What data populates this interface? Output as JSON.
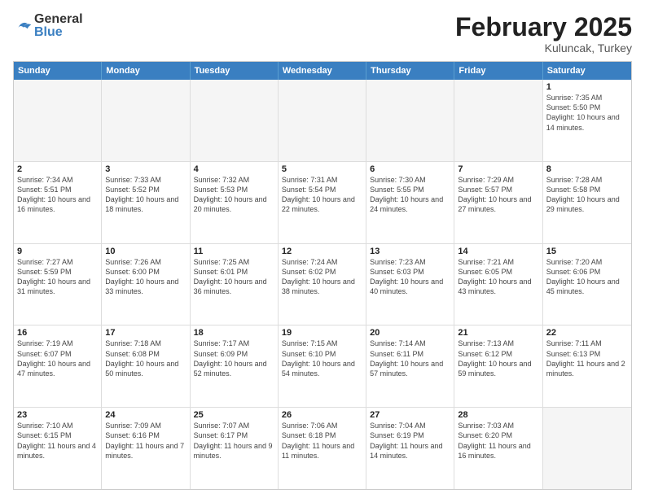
{
  "header": {
    "logo_general": "General",
    "logo_blue": "Blue",
    "title": "February 2025",
    "subtitle": "Kuluncak, Turkey"
  },
  "days_of_week": [
    "Sunday",
    "Monday",
    "Tuesday",
    "Wednesday",
    "Thursday",
    "Friday",
    "Saturday"
  ],
  "weeks": [
    [
      {
        "day": "",
        "info": ""
      },
      {
        "day": "",
        "info": ""
      },
      {
        "day": "",
        "info": ""
      },
      {
        "day": "",
        "info": ""
      },
      {
        "day": "",
        "info": ""
      },
      {
        "day": "",
        "info": ""
      },
      {
        "day": "1",
        "info": "Sunrise: 7:35 AM\nSunset: 5:50 PM\nDaylight: 10 hours and 14 minutes."
      }
    ],
    [
      {
        "day": "2",
        "info": "Sunrise: 7:34 AM\nSunset: 5:51 PM\nDaylight: 10 hours and 16 minutes."
      },
      {
        "day": "3",
        "info": "Sunrise: 7:33 AM\nSunset: 5:52 PM\nDaylight: 10 hours and 18 minutes."
      },
      {
        "day": "4",
        "info": "Sunrise: 7:32 AM\nSunset: 5:53 PM\nDaylight: 10 hours and 20 minutes."
      },
      {
        "day": "5",
        "info": "Sunrise: 7:31 AM\nSunset: 5:54 PM\nDaylight: 10 hours and 22 minutes."
      },
      {
        "day": "6",
        "info": "Sunrise: 7:30 AM\nSunset: 5:55 PM\nDaylight: 10 hours and 24 minutes."
      },
      {
        "day": "7",
        "info": "Sunrise: 7:29 AM\nSunset: 5:57 PM\nDaylight: 10 hours and 27 minutes."
      },
      {
        "day": "8",
        "info": "Sunrise: 7:28 AM\nSunset: 5:58 PM\nDaylight: 10 hours and 29 minutes."
      }
    ],
    [
      {
        "day": "9",
        "info": "Sunrise: 7:27 AM\nSunset: 5:59 PM\nDaylight: 10 hours and 31 minutes."
      },
      {
        "day": "10",
        "info": "Sunrise: 7:26 AM\nSunset: 6:00 PM\nDaylight: 10 hours and 33 minutes."
      },
      {
        "day": "11",
        "info": "Sunrise: 7:25 AM\nSunset: 6:01 PM\nDaylight: 10 hours and 36 minutes."
      },
      {
        "day": "12",
        "info": "Sunrise: 7:24 AM\nSunset: 6:02 PM\nDaylight: 10 hours and 38 minutes."
      },
      {
        "day": "13",
        "info": "Sunrise: 7:23 AM\nSunset: 6:03 PM\nDaylight: 10 hours and 40 minutes."
      },
      {
        "day": "14",
        "info": "Sunrise: 7:21 AM\nSunset: 6:05 PM\nDaylight: 10 hours and 43 minutes."
      },
      {
        "day": "15",
        "info": "Sunrise: 7:20 AM\nSunset: 6:06 PM\nDaylight: 10 hours and 45 minutes."
      }
    ],
    [
      {
        "day": "16",
        "info": "Sunrise: 7:19 AM\nSunset: 6:07 PM\nDaylight: 10 hours and 47 minutes."
      },
      {
        "day": "17",
        "info": "Sunrise: 7:18 AM\nSunset: 6:08 PM\nDaylight: 10 hours and 50 minutes."
      },
      {
        "day": "18",
        "info": "Sunrise: 7:17 AM\nSunset: 6:09 PM\nDaylight: 10 hours and 52 minutes."
      },
      {
        "day": "19",
        "info": "Sunrise: 7:15 AM\nSunset: 6:10 PM\nDaylight: 10 hours and 54 minutes."
      },
      {
        "day": "20",
        "info": "Sunrise: 7:14 AM\nSunset: 6:11 PM\nDaylight: 10 hours and 57 minutes."
      },
      {
        "day": "21",
        "info": "Sunrise: 7:13 AM\nSunset: 6:12 PM\nDaylight: 10 hours and 59 minutes."
      },
      {
        "day": "22",
        "info": "Sunrise: 7:11 AM\nSunset: 6:13 PM\nDaylight: 11 hours and 2 minutes."
      }
    ],
    [
      {
        "day": "23",
        "info": "Sunrise: 7:10 AM\nSunset: 6:15 PM\nDaylight: 11 hours and 4 minutes."
      },
      {
        "day": "24",
        "info": "Sunrise: 7:09 AM\nSunset: 6:16 PM\nDaylight: 11 hours and 7 minutes."
      },
      {
        "day": "25",
        "info": "Sunrise: 7:07 AM\nSunset: 6:17 PM\nDaylight: 11 hours and 9 minutes."
      },
      {
        "day": "26",
        "info": "Sunrise: 7:06 AM\nSunset: 6:18 PM\nDaylight: 11 hours and 11 minutes."
      },
      {
        "day": "27",
        "info": "Sunrise: 7:04 AM\nSunset: 6:19 PM\nDaylight: 11 hours and 14 minutes."
      },
      {
        "day": "28",
        "info": "Sunrise: 7:03 AM\nSunset: 6:20 PM\nDaylight: 11 hours and 16 minutes."
      },
      {
        "day": "",
        "info": ""
      }
    ]
  ]
}
